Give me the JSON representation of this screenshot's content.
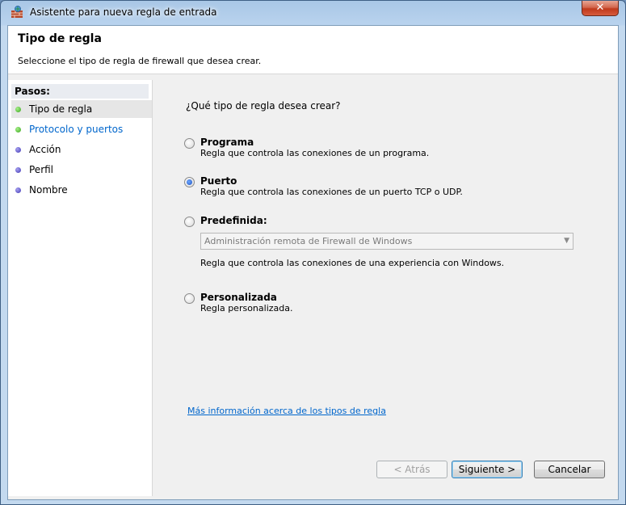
{
  "window": {
    "title": "Asistente para nueva regla de entrada",
    "close_label": "✕"
  },
  "header": {
    "title": "Tipo de regla",
    "description": "Seleccione el tipo de regla de firewall que desea crear."
  },
  "steps": {
    "title": "Pasos:",
    "items": [
      {
        "label": "Tipo de regla",
        "status": "green",
        "current": true
      },
      {
        "label": "Protocolo y puertos",
        "status": "green",
        "link": true
      },
      {
        "label": "Acción",
        "status": "blue"
      },
      {
        "label": "Perfil",
        "status": "blue"
      },
      {
        "label": "Nombre",
        "status": "blue"
      }
    ]
  },
  "main": {
    "question": "¿Qué tipo de regla desea crear?",
    "options": [
      {
        "label": "Programa",
        "description": "Regla que controla las conexiones de un programa.",
        "checked": false
      },
      {
        "label": "Puerto",
        "description": "Regla que controla las conexiones de un puerto TCP o UDP.",
        "checked": true
      },
      {
        "label": "Predefinida:",
        "checked": false
      },
      {
        "label": "Personalizada",
        "description": "Regla personalizada.",
        "checked": false
      }
    ],
    "predefined_select": "Administración remota de Firewall de Windows",
    "predefined_description": "Regla que controla las conexiones de una experiencia con Windows.",
    "more_info_link": "Más información acerca de los tipos de regla"
  },
  "buttons": {
    "back": "< Atrás",
    "next": "Siguiente >",
    "cancel": "Cancelar"
  },
  "colors": {
    "link": "#0066cc",
    "step_done": "#36a41c",
    "step_pending": "#3f36b4"
  }
}
